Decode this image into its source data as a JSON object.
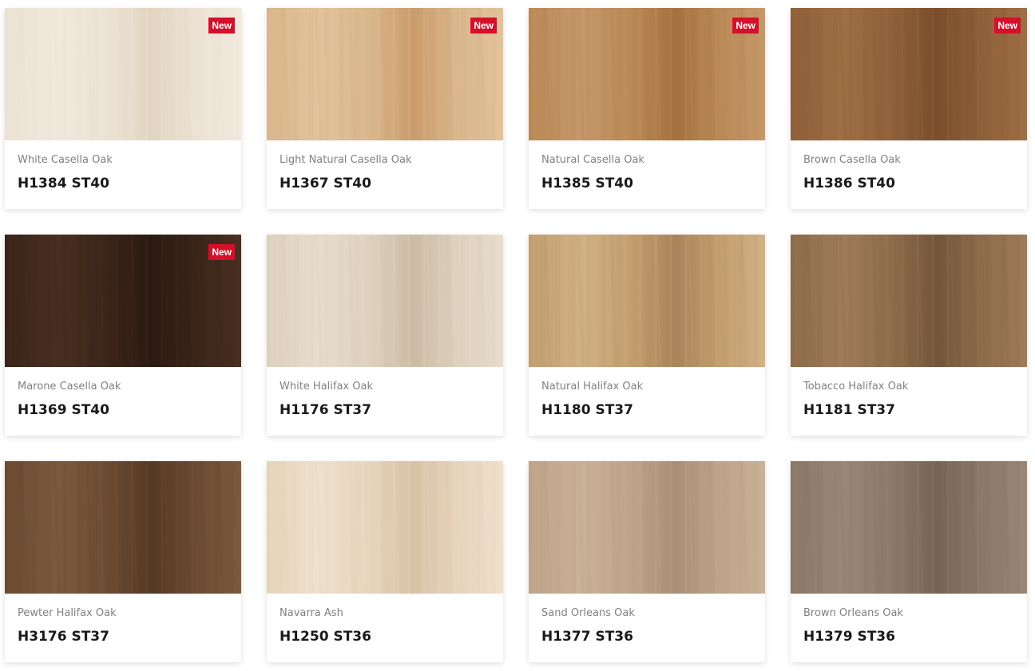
{
  "decors": [
    {
      "name": "White Casella Oak",
      "code": "H1384 ST40",
      "badge": "New",
      "colors": [
        "#ece2d4",
        "#e2d4c1",
        "#f1e9dd"
      ]
    },
    {
      "name": "Light Natural Casella Oak",
      "code": "H1367 ST40",
      "badge": "New",
      "colors": [
        "#d9b68c",
        "#c99c6b",
        "#e3c39b"
      ]
    },
    {
      "name": "Natural Casella Oak",
      "code": "H1385 ST40",
      "badge": "New",
      "colors": [
        "#b98955",
        "#a4713e",
        "#c6986a"
      ]
    },
    {
      "name": "Brown Casella Oak",
      "code": "H1386 ST40",
      "badge": "New",
      "colors": [
        "#8e5f38",
        "#7a4e2b",
        "#9f6f46"
      ]
    },
    {
      "name": "Marone Casella Oak",
      "code": "H1369 ST40",
      "badge": "New",
      "colors": [
        "#3a2419",
        "#2b1a12",
        "#4a2f21"
      ]
    },
    {
      "name": "White Halifax Oak",
      "code": "H1176 ST37",
      "badge": "",
      "colors": [
        "#ddd0bd",
        "#cbbba4",
        "#e8ddcc"
      ]
    },
    {
      "name": "Natural Halifax Oak",
      "code": "H1180 ST37",
      "badge": "",
      "colors": [
        "#c19d6f",
        "#a9845a",
        "#d2b185"
      ]
    },
    {
      "name": "Tobacco Halifax Oak",
      "code": "H1181 ST37",
      "badge": "",
      "colors": [
        "#8d6a4a",
        "#74553a",
        "#a07c5a"
      ]
    },
    {
      "name": "Pewter Halifax Oak",
      "code": "H3176 ST37",
      "badge": "",
      "colors": [
        "#6b4a31",
        "#553923",
        "#7d5a3d"
      ]
    },
    {
      "name": "Navarra Ash",
      "code": "H1250 ST36",
      "badge": "",
      "colors": [
        "#e5d3bb",
        "#d8c2a5",
        "#efe1cd"
      ]
    },
    {
      "name": "Sand Orleans Oak",
      "code": "H1377 ST36",
      "badge": "",
      "colors": [
        "#bda388",
        "#a88f75",
        "#cab296"
      ]
    },
    {
      "name": "Brown Orleans Oak",
      "code": "H1379 ST36",
      "badge": "",
      "colors": [
        "#8a7767",
        "#756354",
        "#9a8777"
      ]
    }
  ]
}
